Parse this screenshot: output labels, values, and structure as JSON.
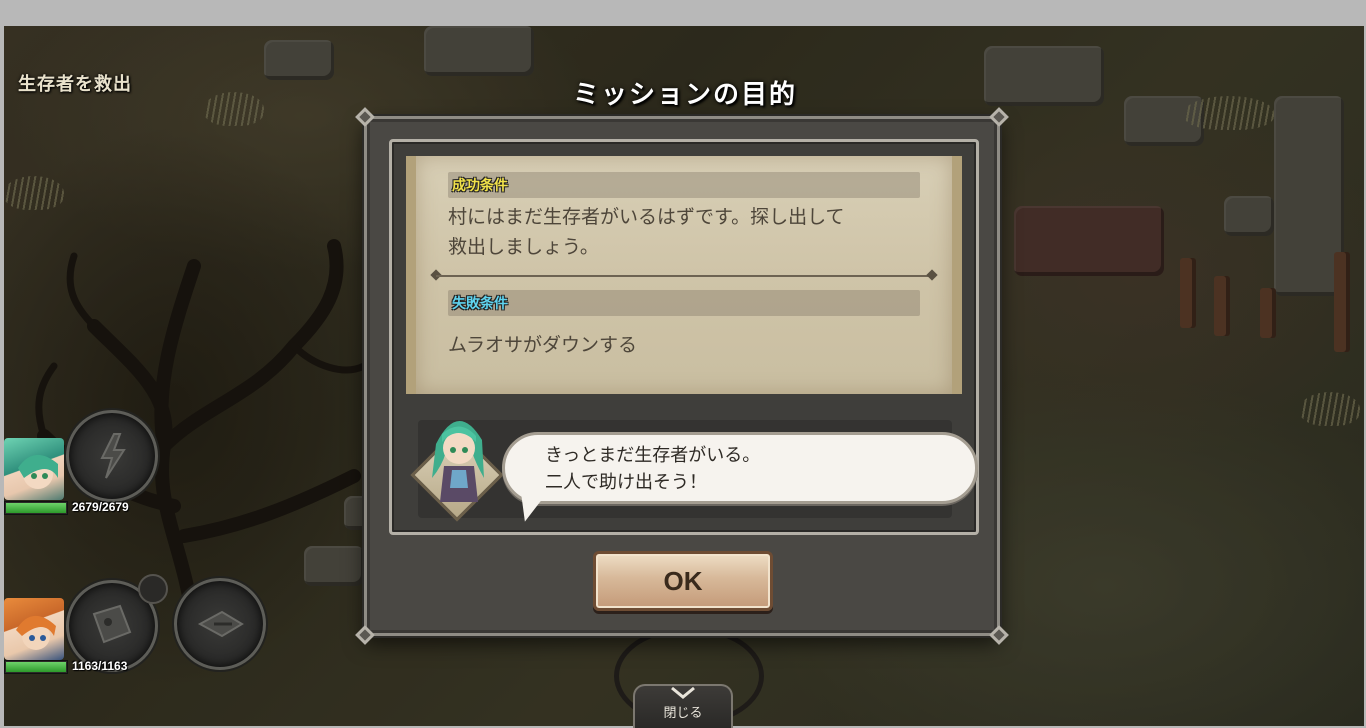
{
  "hud": {
    "mission_name": "生存者を救出"
  },
  "party": [
    {
      "name": "green-haired-heroine",
      "hp_current": 2679,
      "hp_max": 2679,
      "hp_text": "2679/2679",
      "hp_fraction": 1.0
    },
    {
      "name": "orange-haired-hero",
      "hp_current": 1163,
      "hp_max": 1163,
      "hp_text": "1163/1163",
      "hp_fraction": 1.0
    }
  ],
  "dialog": {
    "title": "ミッションの目的",
    "success_label": "成功条件",
    "success_text_line1": "村にはまだ生存者がいるはずです。探し出して",
    "success_text_line2": "救出しましょう。",
    "failure_label": "失敗条件",
    "failure_text": "ムラオサがダウンする",
    "speech_line1": "きっとまだ生存者がいる。",
    "speech_line2": "二人で助け出そう！",
    "ok_label": "OK"
  },
  "close_tab": {
    "label": "閉じる"
  },
  "colors": {
    "success_label": "#f2e24a",
    "failure_label": "#5fd3ee",
    "hp_fill": "#3fb33c"
  }
}
